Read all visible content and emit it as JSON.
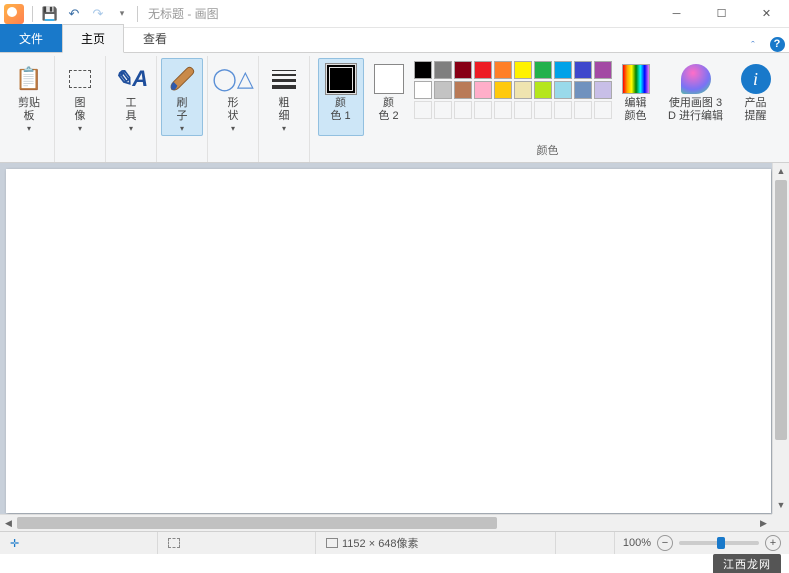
{
  "title": "无标题 - 画图",
  "tabs": {
    "file": "文件",
    "home": "主页",
    "view": "查看"
  },
  "ribbon": {
    "clipboard": {
      "label": "剪贴\n板",
      "dd": "▾"
    },
    "image": {
      "label": "图\n像",
      "dd": "▾"
    },
    "tools": {
      "label": "工\n具",
      "dd": "▾"
    },
    "brushes": {
      "label": "刷\n子",
      "dd": "▾"
    },
    "shapes": {
      "label": "形\n状",
      "dd": "▾"
    },
    "size": {
      "label": "粗\n细",
      "dd": "▾"
    },
    "color1": {
      "label": "颜\n色 1"
    },
    "color2": {
      "label": "颜\n色 2"
    },
    "edit_colors": {
      "label": "编辑\n颜色"
    },
    "paint3d": {
      "label": "使用画图 3\nD 进行编辑"
    },
    "alerts": {
      "label": "产品\n提醒"
    },
    "group_colors": "颜色"
  },
  "palette": {
    "row1": [
      "#000000",
      "#7f7f7f",
      "#880015",
      "#ed1c24",
      "#ff7f27",
      "#fff200",
      "#22b14c",
      "#00a2e8",
      "#3f48cc",
      "#a349a4"
    ],
    "row2": [
      "#ffffff",
      "#c3c3c3",
      "#b97a57",
      "#ffaec9",
      "#ffc90e",
      "#efe4b0",
      "#b5e61d",
      "#99d9ea",
      "#7092be",
      "#c8bfe7"
    ],
    "row3": [
      "#f5f6f7",
      "#f5f6f7",
      "#f5f6f7",
      "#f5f6f7",
      "#f5f6f7",
      "#f5f6f7",
      "#f5f6f7",
      "#f5f6f7",
      "#f5f6f7",
      "#f5f6f7"
    ]
  },
  "status": {
    "dimensions": "1152 × 648像素",
    "zoom": "100%"
  },
  "watermark": "江西龙网"
}
